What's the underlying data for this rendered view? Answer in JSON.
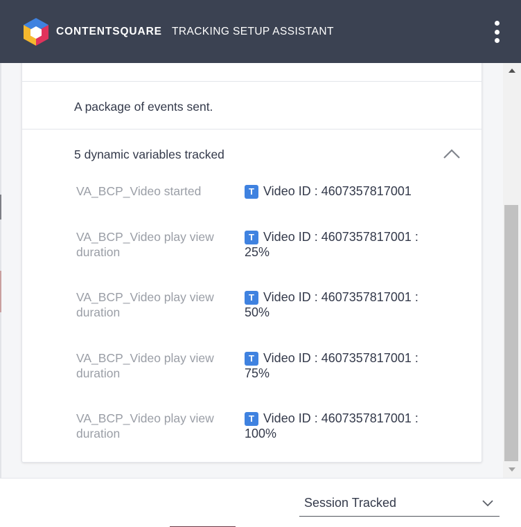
{
  "header": {
    "brand": "CONTENTSQUARE",
    "subtitle": "TRACKING SETUP ASSISTANT",
    "menu_icon": "kebab-menu-icon",
    "colors": {
      "background": "#3b4252",
      "logo_blue": "#3f82e0",
      "logo_red": "#e0335c",
      "logo_yellow": "#f5b82e"
    }
  },
  "panel": {
    "description": "A package of events sent.",
    "section_title": "5 dynamic variables tracked",
    "collapse_icon": "chevron-up-icon",
    "badge_letter": "T",
    "badge_color": "#3f82e0",
    "variables": [
      {
        "name": "VA_BCP_Video started",
        "value": "Video ID : 4607357817001"
      },
      {
        "name": "VA_BCP_Video play view duration",
        "value": "Video ID : 4607357817001 : 25%"
      },
      {
        "name": "VA_BCP_Video play view duration",
        "value": "Video ID : 4607357817001 : 50%"
      },
      {
        "name": "VA_BCP_Video play view duration",
        "value": "Video ID : 4607357817001 : 75%"
      },
      {
        "name": "VA_BCP_Video play view duration",
        "value": "Video ID : 4607357817001 : 100%"
      }
    ]
  },
  "footer": {
    "select_value": "Session Tracked",
    "select_icon": "chevron-down-icon"
  }
}
